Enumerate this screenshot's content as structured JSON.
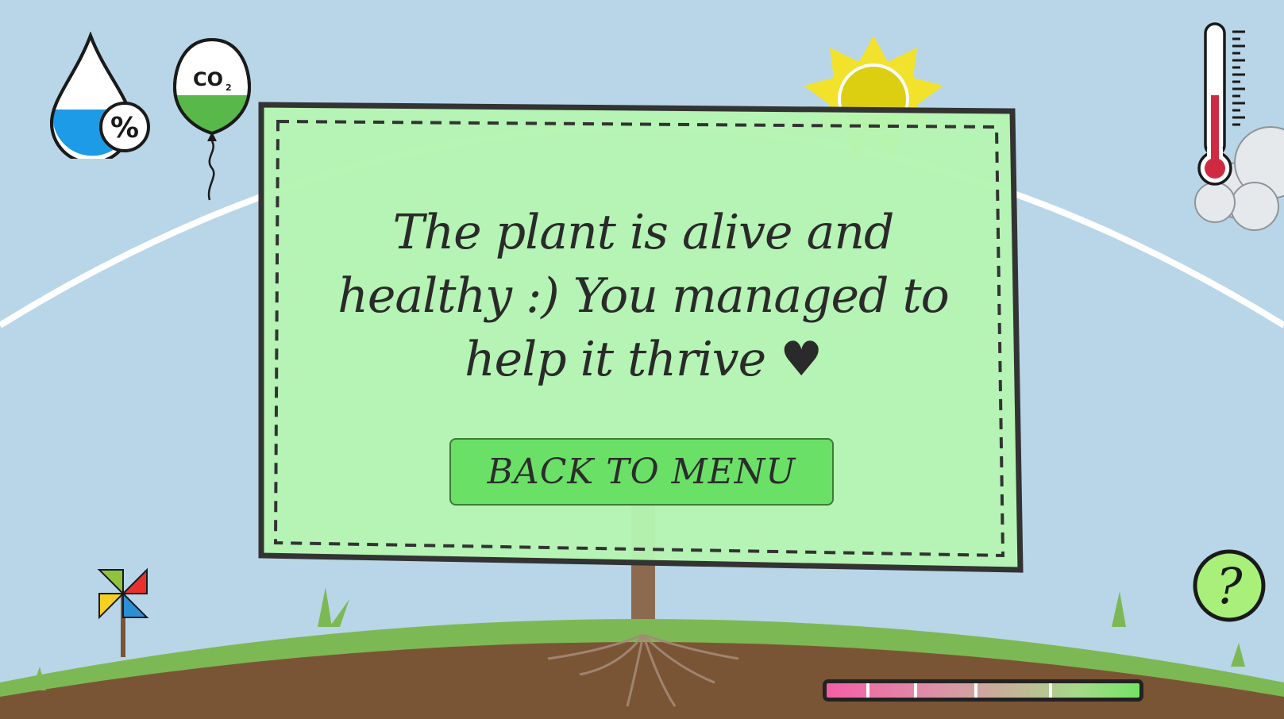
{
  "game": {
    "co2_label": "CO",
    "co2_subscript": "2",
    "humidity_badge": "%",
    "help_label": "?",
    "status_colors": {
      "sky": "#b8d6e8",
      "ground": "#7a5535",
      "grass": "#7cb954",
      "panel": "#b5f5b2",
      "button": "#6be067"
    }
  },
  "icons": {
    "humidity": "water-drop-percent-icon",
    "co2": "co2-balloon-icon",
    "sun": "sun-icon",
    "thermometer": "thermometer-icon",
    "wind": "pinwheel-icon",
    "help": "question-mark-icon"
  },
  "dialog": {
    "message": "The plant is alive and healthy :) You managed to help it thrive ♥",
    "button_label": "BACK TO MENU"
  }
}
